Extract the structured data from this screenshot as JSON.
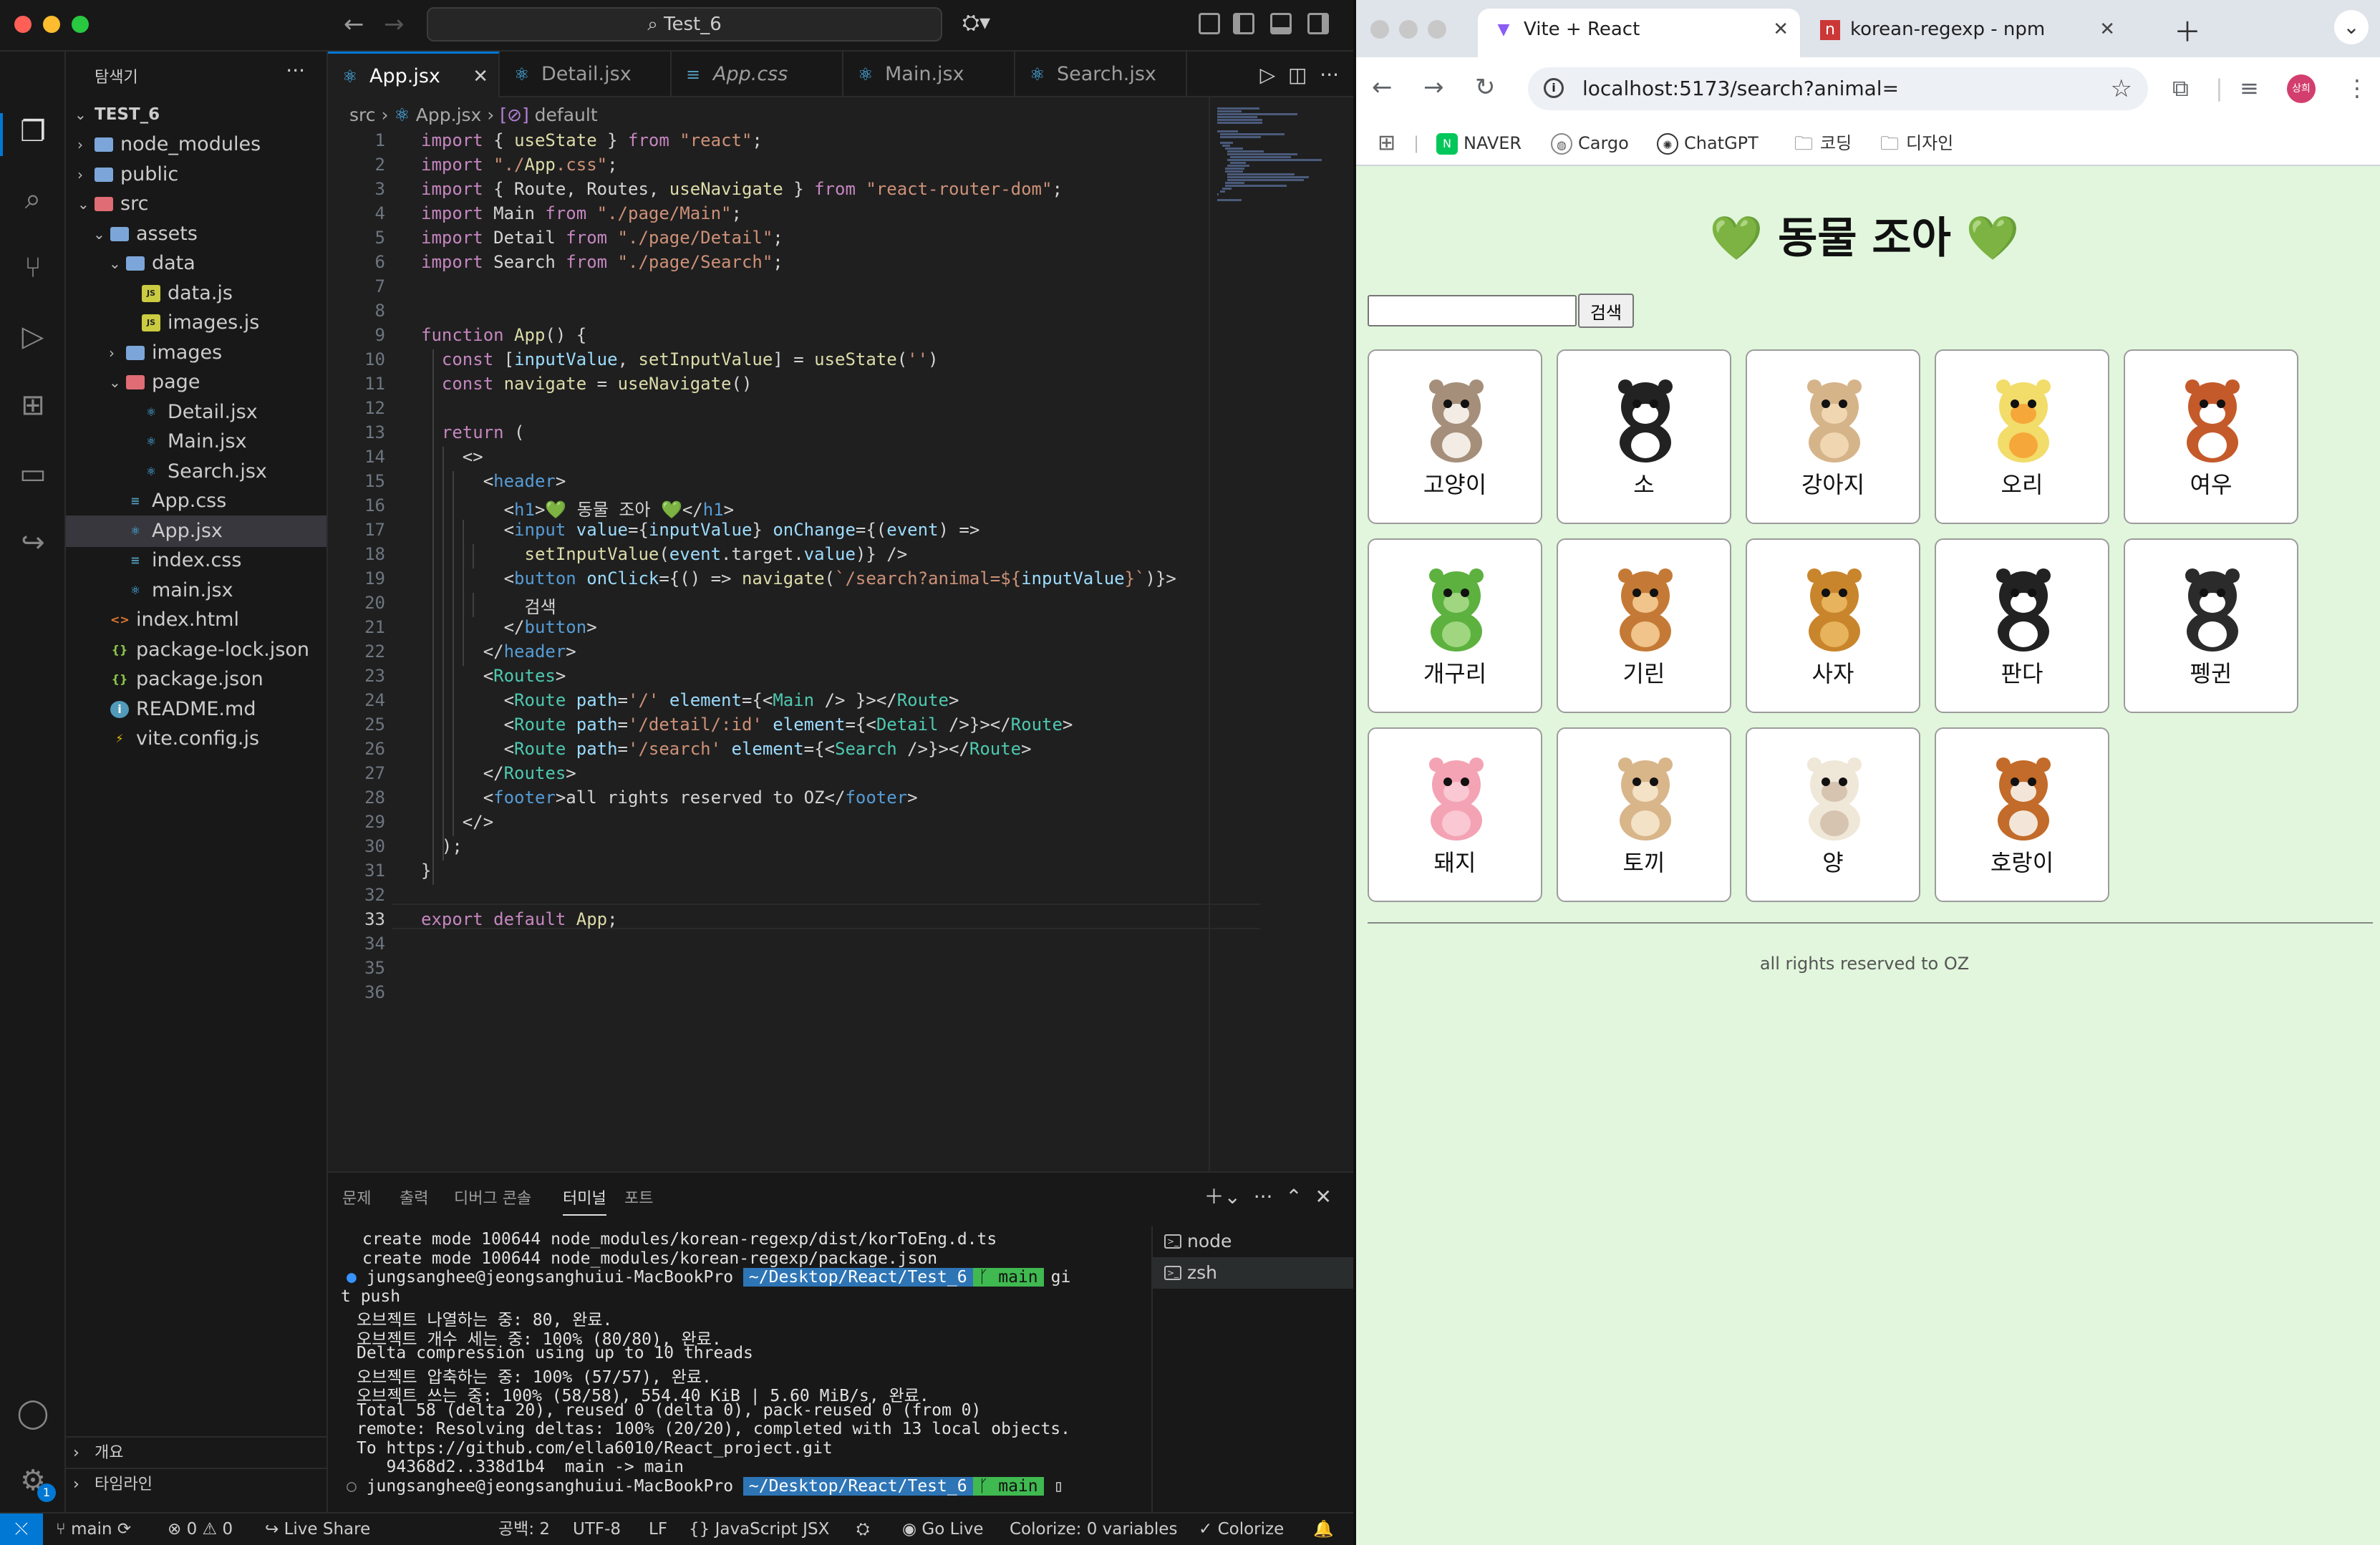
{
  "vscode": {
    "title": "Test_6",
    "explorer_title": "탐색기",
    "project": "TEST_6",
    "tree": [
      {
        "label": "node_modules",
        "type": "folder"
      },
      {
        "label": "public",
        "type": "folder"
      },
      {
        "label": "src",
        "type": "folder"
      },
      {
        "label": "assets",
        "type": "folder"
      },
      {
        "label": "data",
        "type": "folder"
      },
      {
        "label": "data.js",
        "type": "js"
      },
      {
        "label": "images.js",
        "type": "js"
      },
      {
        "label": "images",
        "type": "folder"
      },
      {
        "label": "page",
        "type": "folder"
      },
      {
        "label": "Detail.jsx",
        "type": "jsx"
      },
      {
        "label": "Main.jsx",
        "type": "jsx"
      },
      {
        "label": "Search.jsx",
        "type": "jsx"
      },
      {
        "label": "App.css",
        "type": "css"
      },
      {
        "label": "App.jsx",
        "type": "jsx"
      },
      {
        "label": "index.css",
        "type": "css"
      },
      {
        "label": "main.jsx",
        "type": "jsx"
      },
      {
        "label": "index.html",
        "type": "html"
      },
      {
        "label": "package-lock.json",
        "type": "json"
      },
      {
        "label": "package.json",
        "type": "json"
      },
      {
        "label": "README.md",
        "type": "info"
      },
      {
        "label": "vite.config.js",
        "type": "vite"
      }
    ],
    "outline": "개요",
    "timeline": "타임라인",
    "tabs": [
      "App.jsx",
      "Detail.jsx",
      "App.css",
      "Main.jsx",
      "Search.jsx"
    ],
    "breadcrumb": {
      "a": "src",
      "b": "App.jsx",
      "c": "default"
    },
    "code_lines": [
      "import { useState } from \"react\";",
      "import \"./App.css\";",
      "import { Route, Routes, useNavigate } from \"react-router-dom\";",
      "import Main from \"./page/Main\";",
      "import Detail from \"./page/Detail\";",
      "import Search from \"./page/Search\";",
      "",
      "",
      "function App() {",
      "  const [inputValue, setInputValue] = useState('')",
      "  const navigate = useNavigate()",
      "",
      "  return (",
      "    <>",
      "      <header>",
      "        <h1>💚 동물 조아 💚</h1>",
      "        <input value={inputValue} onChange={(event) =>",
      "          setInputValue(event.target.value)} />",
      "        <button onClick={() => navigate(`/search?animal=${inputValue}`)}>",
      "          검색",
      "        </button>",
      "      </header>",
      "      <Routes>",
      "        <Route path='/' element={<Main /> }></Route>",
      "        <Route path='/detail/:id' element={<Detail />}></Route>",
      "        <Route path='/search' element={<Search />}></Route>",
      "      </Routes>",
      "      <footer>all rights reserved to OZ</footer>",
      "    </>",
      "  );",
      "}",
      "",
      "export default App;",
      "",
      "",
      ""
    ],
    "panel_tabs": [
      "문제",
      "출력",
      "디버그 콘솔",
      "터미널",
      "포트"
    ],
    "terminal": [
      "create mode 100644 node_modules/korean-regexp/dist/korToEng.d.ts",
      "create mode 100644 node_modules/korean-regexp/package.json",
      "PROMPT1",
      "t push",
      "오브젝트 나열하는 중: 80, 완료.",
      "오브젝트 개수 세는 중: 100% (80/80), 완료.",
      "Delta compression using up to 10 threads",
      "오브젝트 압축하는 중: 100% (57/57), 완료.",
      "오브젝트 쓰는 중: 100% (58/58), 554.40 KiB | 5.60 MiB/s, 완료.",
      "Total 58 (delta 20), reused 0 (delta 0), pack-reused 0 (from 0)",
      "remote: Resolving deltas: 100% (20/20), completed with 13 local objects.",
      "To https://github.com/ella6010/React_project.git",
      "   94368d2..338d1b4  main -> main",
      "PROMPT2"
    ],
    "prompt_user": "jungsanghee@jeongsanghuiui-MacBookPro",
    "prompt_path": "~/Desktop/React/Test_6",
    "prompt_branch": "main",
    "prompt_cmd1": "gi",
    "terminal_list": [
      "node",
      "zsh"
    ],
    "status": {
      "branch": "main",
      "problems": "⊗ 0 ⚠ 0",
      "live_share": "Live Share",
      "spaces": "공백: 2",
      "encoding": "UTF-8",
      "eol": "LF",
      "lang": "JavaScript JSX",
      "golive": "Go Live",
      "colorize_vars": "Colorize: 0 variables",
      "colorize": "Colorize",
      "badge": "1"
    }
  },
  "chrome": {
    "tabs": [
      "Vite + React",
      "korean-regexp - npm"
    ],
    "url": "localhost:5173/search?animal=",
    "avatar": "상희",
    "bookmarks": [
      "NAVER",
      "Cargo",
      "ChatGPT",
      "코딩",
      "디자인"
    ],
    "page": {
      "title": "💚 동물 조아 💚",
      "search_button": "검색",
      "animals": [
        "고양이",
        "소",
        "강아지",
        "오리",
        "여우",
        "개구리",
        "기린",
        "사자",
        "판다",
        "펭귄",
        "돼지",
        "토끼",
        "양",
        "호랑이"
      ],
      "footer": "all rights reserved to OZ"
    }
  }
}
